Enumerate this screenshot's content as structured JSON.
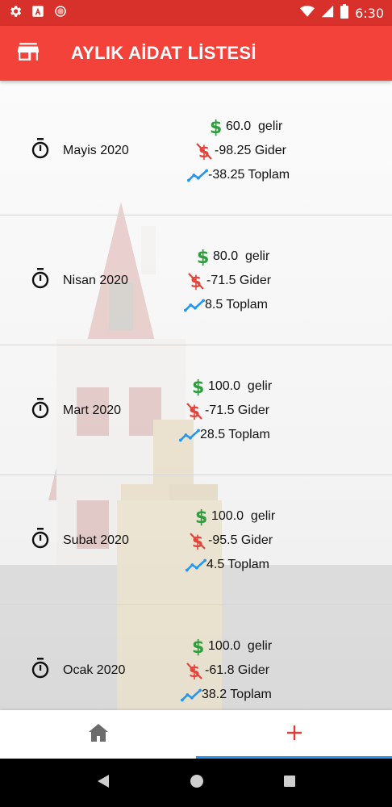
{
  "status_bar": {
    "time": "6:30"
  },
  "app_bar": {
    "title": "AYLIK AİDAT LİSTESİ"
  },
  "months": [
    {
      "name": "Mayis 2020",
      "income": "60.0  gelir",
      "expense": "-98.25 Gider",
      "total": "-38.25 Toplam"
    },
    {
      "name": "Nisan 2020",
      "income": "80.0  gelir",
      "expense": "-71.5 Gider",
      "total": "8.5 Toplam"
    },
    {
      "name": "Mart 2020",
      "income": "100.0  gelir",
      "expense": "-71.5 Gider",
      "total": "28.5 Toplam"
    },
    {
      "name": "Subat 2020",
      "income": "100.0  gelir",
      "expense": "-95.5 Gider",
      "total": "4.5 Toplam"
    },
    {
      "name": "Ocak 2020",
      "income": "100.0  gelir",
      "expense": "-61.8 Gider",
      "total": "38.2 Toplam"
    }
  ],
  "colors": {
    "status_bar": "#d8302a",
    "app_bar": "#f2423a",
    "income_icon": "#2e9d3b",
    "expense_icon": "#e2453c",
    "trend_icon": "#2196f3",
    "nav_active_indicator": "#2196f3",
    "add_icon": "#e53935"
  },
  "icons": {
    "status": [
      "settings-icon",
      "font-icon",
      "record-icon",
      "wifi-icon",
      "signal-icon",
      "battery-icon"
    ],
    "app_bar": "store-icon",
    "row": "timer-icon",
    "income": "dollar-icon",
    "expense": "money-off-icon",
    "total": "trending-icon",
    "bottom_nav": [
      "home-icon",
      "add-icon"
    ],
    "system_nav": [
      "back-icon",
      "home-circle-icon",
      "recents-icon"
    ]
  }
}
